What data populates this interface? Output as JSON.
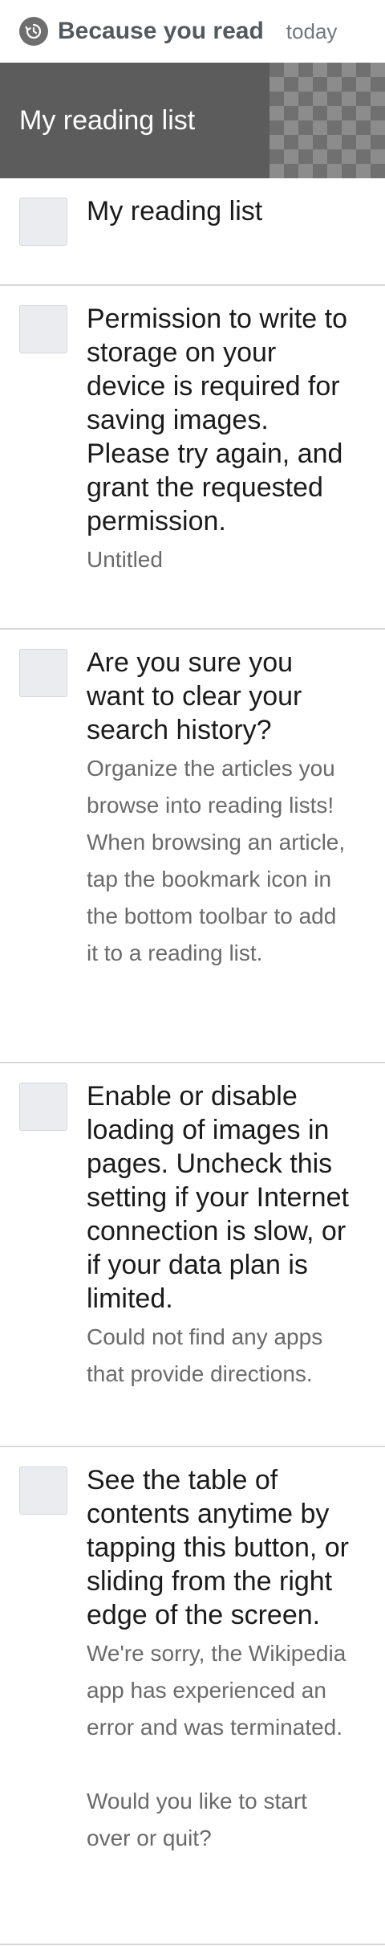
{
  "header": {
    "icon": "history-icon",
    "title": "Because you read",
    "date": "today"
  },
  "banner": {
    "title": "My reading list"
  },
  "items": [
    {
      "title": "My reading list",
      "description": ""
    },
    {
      "title": "Permission to write to storage on your device is required for saving images. Please try again, and grant the requested permission.",
      "description": "Untitled"
    },
    {
      "title": "Are you sure you want to clear your search history?",
      "description": "Organize the articles you browse into reading lists! When browsing an article, tap the bookmark icon in the bottom toolbar to add it to a reading list."
    },
    {
      "title": "Enable or disable loading of images in pages. Uncheck this setting if your Internet connection is slow, or if your data plan is limited.",
      "description": "Could not find any apps that provide directions."
    },
    {
      "title": "See the table of contents anytime by tapping this button, or sliding from the right edge of the screen.",
      "description": "We're sorry, the Wikipedia app has experienced an error and was terminated.\n\nWould you like to start over or quit?"
    }
  ]
}
